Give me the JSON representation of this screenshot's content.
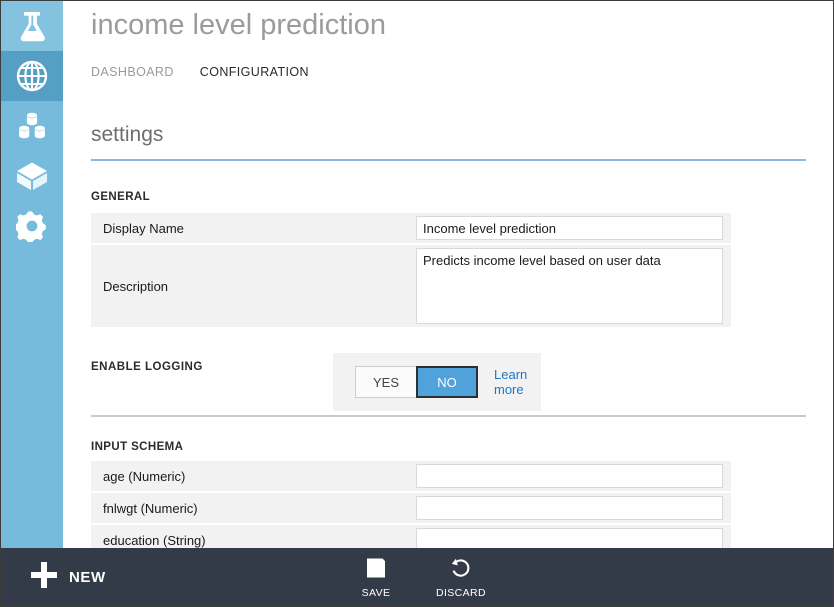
{
  "rail": {
    "items": [
      {
        "name": "experiments",
        "icon": "flask-icon",
        "state": "lighter"
      },
      {
        "name": "web-services",
        "icon": "globe-icon",
        "state": "active"
      },
      {
        "name": "datasets",
        "icon": "datasets-icon",
        "state": "normal"
      },
      {
        "name": "trained-models",
        "icon": "cube-icon",
        "state": "normal"
      },
      {
        "name": "settings",
        "icon": "gear-icon",
        "state": "normal"
      }
    ]
  },
  "header": {
    "title": "income level prediction",
    "tabs": [
      {
        "label": "DASHBOARD",
        "active": false
      },
      {
        "label": "CONFIGURATION",
        "active": true
      }
    ]
  },
  "settings": {
    "heading": "settings",
    "general": {
      "label": "GENERAL",
      "rows": [
        {
          "label": "Display Name",
          "value": "Income level prediction",
          "placeholder": ""
        },
        {
          "label": "Description",
          "value": "Predicts income level based on user data",
          "placeholder": ""
        }
      ]
    },
    "logging": {
      "label": "ENABLE LOGGING",
      "options": [
        {
          "label": "YES",
          "selected": false
        },
        {
          "label": "NO",
          "selected": true
        }
      ],
      "learn_more": "Learn more",
      "accent_color": "#4fa2da",
      "link_color": "#1f77c4"
    },
    "input_schema": {
      "label": "INPUT SCHEMA",
      "rows": [
        {
          "label": "age (Numeric)",
          "value": "",
          "placeholder": ""
        },
        {
          "label": "fnlwgt (Numeric)",
          "value": "",
          "placeholder": ""
        },
        {
          "label": "education (String)",
          "value": "",
          "placeholder": ""
        }
      ]
    }
  },
  "commandbar": {
    "new_label": "NEW",
    "save_label": "SAVE",
    "discard_label": "DISCARD",
    "background_color": "#343b48"
  }
}
